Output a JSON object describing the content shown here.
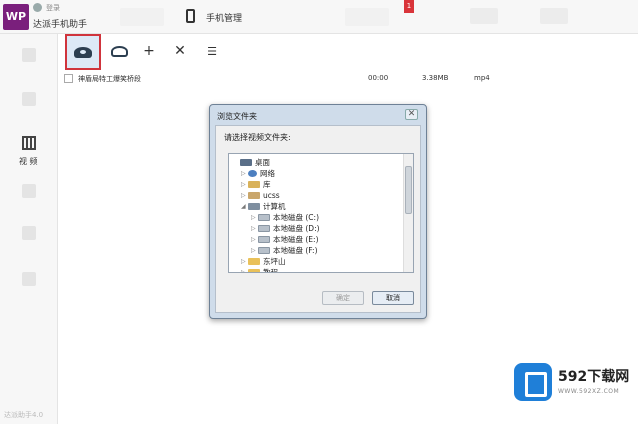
{
  "app": {
    "logo": "WP",
    "login_text": "登录",
    "title": "达派手机助手",
    "phone_tab_label": "手机管理",
    "badge": "1"
  },
  "sidebar": {
    "video_label": "视 频"
  },
  "toolbar": {
    "items": [
      "import-video",
      "export-video",
      "add",
      "delete",
      "select-list"
    ]
  },
  "file_row": {
    "name": "神盾局特工爆笑桥段",
    "duration": "00:00",
    "size": "3.38MB",
    "format": "mp4"
  },
  "status_bar": "达派助手4.0",
  "dialog": {
    "title": "浏览文件夹",
    "close": "✕",
    "prompt": "请选择视频文件夹:",
    "tree": [
      {
        "label": "桌面",
        "icon": "desktop"
      },
      {
        "label": "网络",
        "icon": "network"
      },
      {
        "label": "库",
        "icon": "library"
      },
      {
        "label": "ucss",
        "icon": "user"
      },
      {
        "label": "计算机",
        "icon": "computer"
      },
      {
        "label": "本地磁盘 (C:)",
        "icon": "disk"
      },
      {
        "label": "本地磁盘 (D:)",
        "icon": "disk"
      },
      {
        "label": "本地磁盘 (E:)",
        "icon": "disk"
      },
      {
        "label": "本地磁盘 (F:)",
        "icon": "disk"
      },
      {
        "label": "东坪山",
        "icon": "folder"
      },
      {
        "label": "教程",
        "icon": "folder"
      }
    ],
    "ok_label": "确定",
    "cancel_label": "取消"
  },
  "watermark": {
    "text": "592下载网",
    "url": "WWW.592XZ.COM"
  }
}
